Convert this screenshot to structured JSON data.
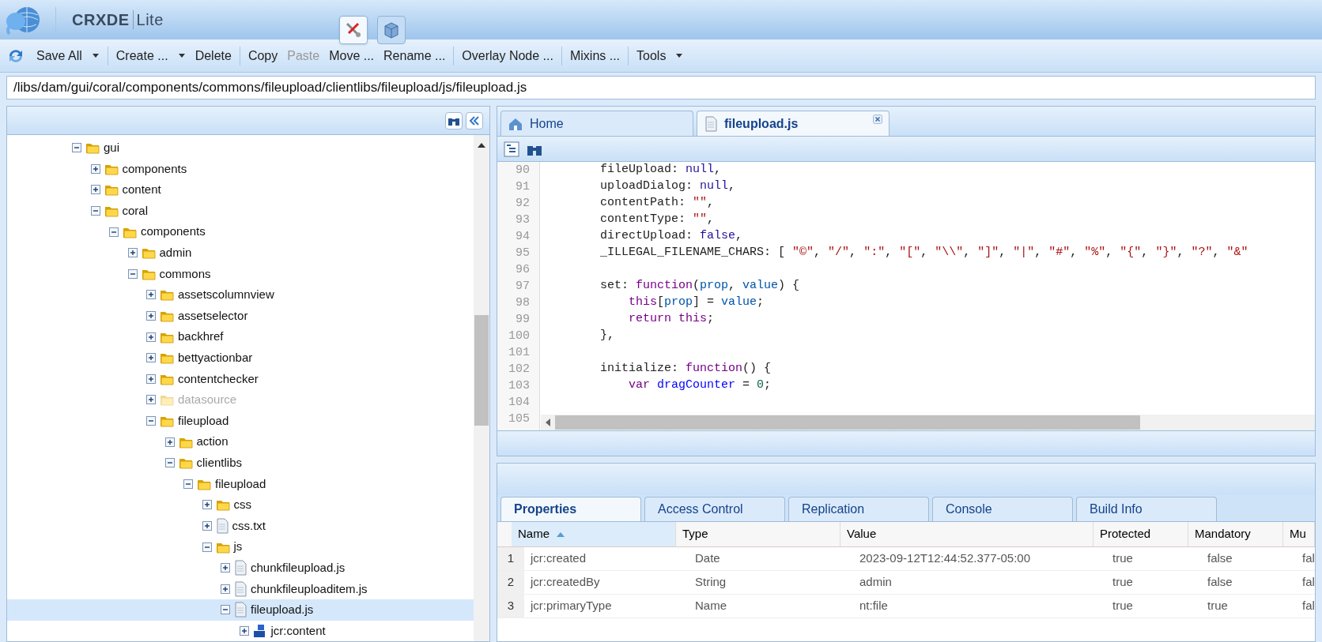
{
  "app": {
    "title_bold": "CRXDE",
    "title_light": "Lite"
  },
  "mode_tabs": [
    {
      "kind": "develop",
      "selected": true
    },
    {
      "kind": "package",
      "selected": false
    }
  ],
  "toolbar": {
    "groups": [
      [
        {
          "label": "Save All",
          "dropdown": true,
          "disabled": false
        }
      ],
      [
        {
          "label": "Create ...",
          "dropdown": true,
          "disabled": false
        },
        {
          "label": "Delete",
          "dropdown": false,
          "disabled": false
        }
      ],
      [
        {
          "label": "Copy",
          "dropdown": false,
          "disabled": false
        },
        {
          "label": "Paste",
          "dropdown": false,
          "disabled": true
        },
        {
          "label": "Move ...",
          "dropdown": false,
          "disabled": false
        },
        {
          "label": "Rename ...",
          "dropdown": false,
          "disabled": false
        }
      ],
      [
        {
          "label": "Overlay Node ...",
          "dropdown": false,
          "disabled": false
        }
      ],
      [
        {
          "label": "Mixins ...",
          "dropdown": false,
          "disabled": false
        }
      ],
      [
        {
          "label": "Tools",
          "dropdown": true,
          "disabled": false
        }
      ]
    ]
  },
  "path": {
    "value": "/libs/dam/gui/coral/components/commons/fileupload/clientlibs/fileupload/js/fileupload.js"
  },
  "tree": [
    {
      "label": "gui",
      "kind": "folder",
      "expanded": true,
      "selected": false,
      "disabled": false,
      "children": [
        {
          "label": "components",
          "kind": "folder",
          "expanded": false,
          "selected": false,
          "disabled": false
        },
        {
          "label": "content",
          "kind": "folder",
          "expanded": false,
          "selected": false,
          "disabled": false
        },
        {
          "label": "coral",
          "kind": "folder",
          "expanded": true,
          "selected": false,
          "disabled": false,
          "children": [
            {
              "label": "components",
              "kind": "folder",
              "expanded": true,
              "selected": false,
              "disabled": false,
              "children": [
                {
                  "label": "admin",
                  "kind": "folder",
                  "expanded": false,
                  "selected": false,
                  "disabled": false
                },
                {
                  "label": "commons",
                  "kind": "folder",
                  "expanded": true,
                  "selected": false,
                  "disabled": false,
                  "children": [
                    {
                      "label": "assetscolumnview",
                      "kind": "folder",
                      "expanded": false,
                      "selected": false,
                      "disabled": false
                    },
                    {
                      "label": "assetselector",
                      "kind": "folder",
                      "expanded": false,
                      "selected": false,
                      "disabled": false
                    },
                    {
                      "label": "backhref",
                      "kind": "folder",
                      "expanded": false,
                      "selected": false,
                      "disabled": false
                    },
                    {
                      "label": "bettyactionbar",
                      "kind": "folder",
                      "expanded": false,
                      "selected": false,
                      "disabled": false
                    },
                    {
                      "label": "contentchecker",
                      "kind": "folder",
                      "expanded": false,
                      "selected": false,
                      "disabled": false
                    },
                    {
                      "label": "datasource",
                      "kind": "folder",
                      "expanded": false,
                      "selected": false,
                      "disabled": true
                    },
                    {
                      "label": "fileupload",
                      "kind": "folder",
                      "expanded": true,
                      "selected": false,
                      "disabled": false,
                      "children": [
                        {
                          "label": "action",
                          "kind": "folder",
                          "expanded": false,
                          "selected": false,
                          "disabled": false
                        },
                        {
                          "label": "clientlibs",
                          "kind": "folder",
                          "expanded": true,
                          "selected": false,
                          "disabled": false,
                          "children": [
                            {
                              "label": "fileupload",
                              "kind": "folder",
                              "expanded": true,
                              "selected": false,
                              "disabled": false,
                              "children": [
                                {
                                  "label": "css",
                                  "kind": "folder",
                                  "expanded": false,
                                  "selected": false,
                                  "disabled": false
                                },
                                {
                                  "label": "css.txt",
                                  "kind": "file",
                                  "expanded": false,
                                  "selected": false,
                                  "disabled": false
                                },
                                {
                                  "label": "js",
                                  "kind": "folder",
                                  "expanded": true,
                                  "selected": false,
                                  "disabled": false,
                                  "children": [
                                    {
                                      "label": "chunkfileupload.js",
                                      "kind": "file",
                                      "expanded": false,
                                      "selected": false,
                                      "disabled": false
                                    },
                                    {
                                      "label": "chunkfileuploaditem.js",
                                      "kind": "file",
                                      "expanded": false,
                                      "selected": false,
                                      "disabled": false
                                    },
                                    {
                                      "label": "fileupload.js",
                                      "kind": "file",
                                      "expanded": true,
                                      "selected": true,
                                      "disabled": false,
                                      "children": [
                                        {
                                          "label": "jcr:content",
                                          "kind": "node",
                                          "expanded": false,
                                          "selected": false,
                                          "disabled": false
                                        }
                                      ]
                                    }
                                  ]
                                }
                              ]
                            }
                          ]
                        }
                      ]
                    }
                  ]
                }
              ]
            }
          ]
        }
      ]
    }
  ],
  "editor_tabs": [
    {
      "label": "Home",
      "kind": "home",
      "selected": false,
      "closable": false
    },
    {
      "label": "fileupload.js",
      "kind": "file",
      "selected": true,
      "closable": true
    }
  ],
  "code": {
    "lines": [
      {
        "number": "90",
        "tokens": [
          {
            "text": "        fileUpload: ",
            "kind": "plain"
          },
          {
            "text": "null",
            "kind": "atom"
          },
          {
            "text": ",",
            "kind": "plain"
          }
        ]
      },
      {
        "number": "91",
        "tokens": [
          {
            "text": "        uploadDialog: ",
            "kind": "plain"
          },
          {
            "text": "null",
            "kind": "atom"
          },
          {
            "text": ",",
            "kind": "plain"
          }
        ]
      },
      {
        "number": "92",
        "tokens": [
          {
            "text": "        contentPath: ",
            "kind": "plain"
          },
          {
            "text": "\"\"",
            "kind": "string"
          },
          {
            "text": ",",
            "kind": "plain"
          }
        ]
      },
      {
        "number": "93",
        "tokens": [
          {
            "text": "        contentType: ",
            "kind": "plain"
          },
          {
            "text": "\"\"",
            "kind": "string"
          },
          {
            "text": ",",
            "kind": "plain"
          }
        ]
      },
      {
        "number": "94",
        "tokens": [
          {
            "text": "        directUpload: ",
            "kind": "plain"
          },
          {
            "text": "false",
            "kind": "atom"
          },
          {
            "text": ",",
            "kind": "plain"
          }
        ]
      },
      {
        "number": "95",
        "tokens": [
          {
            "text": "        _ILLEGAL_FILENAME_CHARS: [ ",
            "kind": "plain"
          },
          {
            "text": "\"©\"",
            "kind": "string"
          },
          {
            "text": ", ",
            "kind": "plain"
          },
          {
            "text": "\"/\"",
            "kind": "string"
          },
          {
            "text": ", ",
            "kind": "plain"
          },
          {
            "text": "\":\"",
            "kind": "string"
          },
          {
            "text": ", ",
            "kind": "plain"
          },
          {
            "text": "\"[\"",
            "kind": "string"
          },
          {
            "text": ", ",
            "kind": "plain"
          },
          {
            "text": "\"\\\\\"",
            "kind": "string"
          },
          {
            "text": ", ",
            "kind": "plain"
          },
          {
            "text": "\"]\"",
            "kind": "string"
          },
          {
            "text": ", ",
            "kind": "plain"
          },
          {
            "text": "\"|\"",
            "kind": "string"
          },
          {
            "text": ", ",
            "kind": "plain"
          },
          {
            "text": "\"#\"",
            "kind": "string"
          },
          {
            "text": ", ",
            "kind": "plain"
          },
          {
            "text": "\"%\"",
            "kind": "string"
          },
          {
            "text": ", ",
            "kind": "plain"
          },
          {
            "text": "\"{\"",
            "kind": "string"
          },
          {
            "text": ", ",
            "kind": "plain"
          },
          {
            "text": "\"}\"",
            "kind": "string"
          },
          {
            "text": ", ",
            "kind": "plain"
          },
          {
            "text": "\"?\"",
            "kind": "string"
          },
          {
            "text": ", ",
            "kind": "plain"
          },
          {
            "text": "\"&\"",
            "kind": "string"
          }
        ]
      },
      {
        "number": "96"
      },
      {
        "number": "97",
        "tokens": [
          {
            "text": "        set: ",
            "kind": "plain"
          },
          {
            "text": "function",
            "kind": "keyword"
          },
          {
            "text": "(",
            "kind": "plain"
          },
          {
            "text": "prop",
            "kind": "variable"
          },
          {
            "text": ", ",
            "kind": "plain"
          },
          {
            "text": "value",
            "kind": "variable"
          },
          {
            "text": ") {",
            "kind": "plain"
          }
        ]
      },
      {
        "number": "98",
        "tokens": [
          {
            "text": "            this",
            "kind": "keyword"
          },
          {
            "text": "[",
            "kind": "plain"
          },
          {
            "text": "prop",
            "kind": "variable"
          },
          {
            "text": "] = ",
            "kind": "plain"
          },
          {
            "text": "value",
            "kind": "variable"
          },
          {
            "text": ";",
            "kind": "plain"
          }
        ]
      },
      {
        "number": "99",
        "tokens": [
          {
            "text": "            return this",
            "kind": "keyword"
          },
          {
            "text": ";",
            "kind": "plain"
          }
        ]
      },
      {
        "number": "100",
        "tokens": [
          {
            "text": "        },",
            "kind": "plain"
          }
        ]
      },
      {
        "number": "101"
      },
      {
        "number": "102",
        "tokens": [
          {
            "text": "        initialize: ",
            "kind": "plain"
          },
          {
            "text": "function",
            "kind": "keyword"
          },
          {
            "text": "() {",
            "kind": "plain"
          }
        ]
      },
      {
        "number": "103",
        "tokens": [
          {
            "text": "            var ",
            "kind": "keyword"
          },
          {
            "text": "dragCounter",
            "kind": "def"
          },
          {
            "text": " = ",
            "kind": "plain"
          },
          {
            "text": "0",
            "kind": "number"
          },
          {
            "text": ";",
            "kind": "plain"
          }
        ]
      },
      {
        "number": "104"
      },
      {
        "number": "105"
      }
    ]
  },
  "bottom_tabs": [
    {
      "label": "Properties",
      "selected": true
    },
    {
      "label": "Access Control",
      "selected": false
    },
    {
      "label": "Replication",
      "selected": false
    },
    {
      "label": "Console",
      "selected": false
    },
    {
      "label": "Build Info",
      "selected": false
    }
  ],
  "properties": {
    "columns": [
      {
        "label": "Name",
        "sorted": true
      },
      {
        "label": "Type",
        "sorted": false
      },
      {
        "label": "Value",
        "sorted": false
      },
      {
        "label": "Protected",
        "sorted": false
      },
      {
        "label": "Mandatory",
        "sorted": false
      },
      {
        "label": "Mu",
        "sorted": false
      }
    ],
    "rows": [
      {
        "index": "1",
        "cells": [
          "jcr:created",
          "Date",
          "2023-09-12T12:44:52.377-05:00",
          "true",
          "false",
          "fal"
        ]
      },
      {
        "index": "2",
        "cells": [
          "jcr:createdBy",
          "String",
          "admin",
          "true",
          "false",
          "fal"
        ]
      },
      {
        "index": "3",
        "cells": [
          "jcr:primaryType",
          "Name",
          "nt:file",
          "true",
          "true",
          "fal"
        ]
      }
    ]
  }
}
